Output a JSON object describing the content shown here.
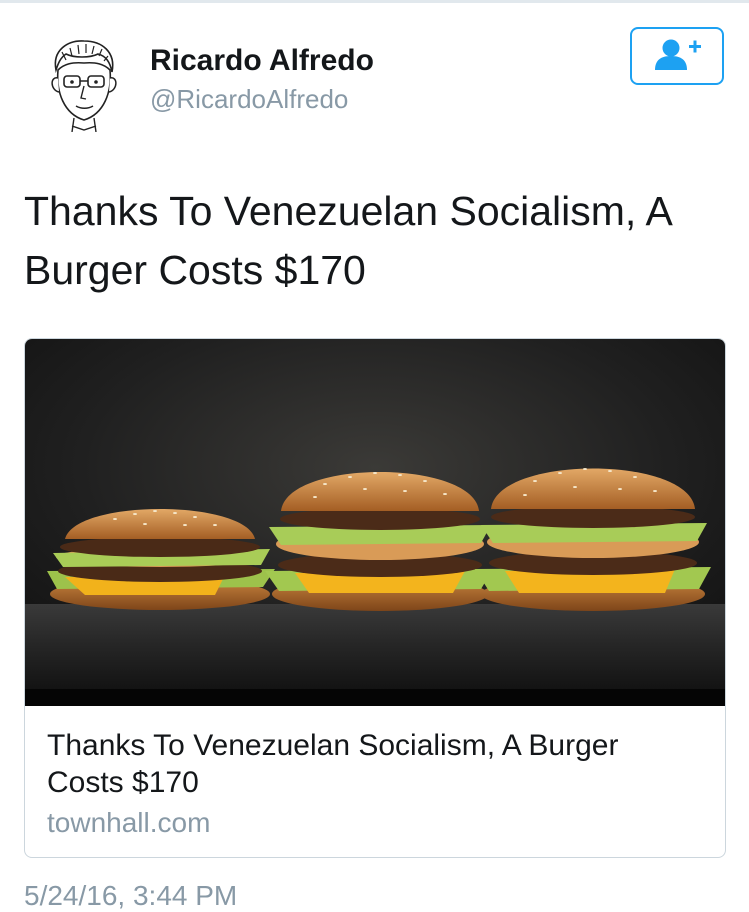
{
  "author": {
    "name": "Ricardo Alfredo",
    "handle": "@RicardoAlfredo",
    "avatar_icon": "sketch-portrait-avatar"
  },
  "follow_button": {
    "icon": "add-user-icon",
    "accent": "#1da1f2"
  },
  "tweet": {
    "text": "Thanks To Venezuelan Socialism, A Burger Costs $170"
  },
  "card": {
    "image_description_icon": "burger-photo",
    "title": "Thanks To Venezuelan Socialism, A Burger Costs $170",
    "domain": "townhall.com"
  },
  "timestamp": "5/24/16, 3:44 PM",
  "colors": {
    "text": "#14171a",
    "secondary": "#8899a6",
    "border": "#ccd6dd",
    "accent": "#1da1f2"
  }
}
